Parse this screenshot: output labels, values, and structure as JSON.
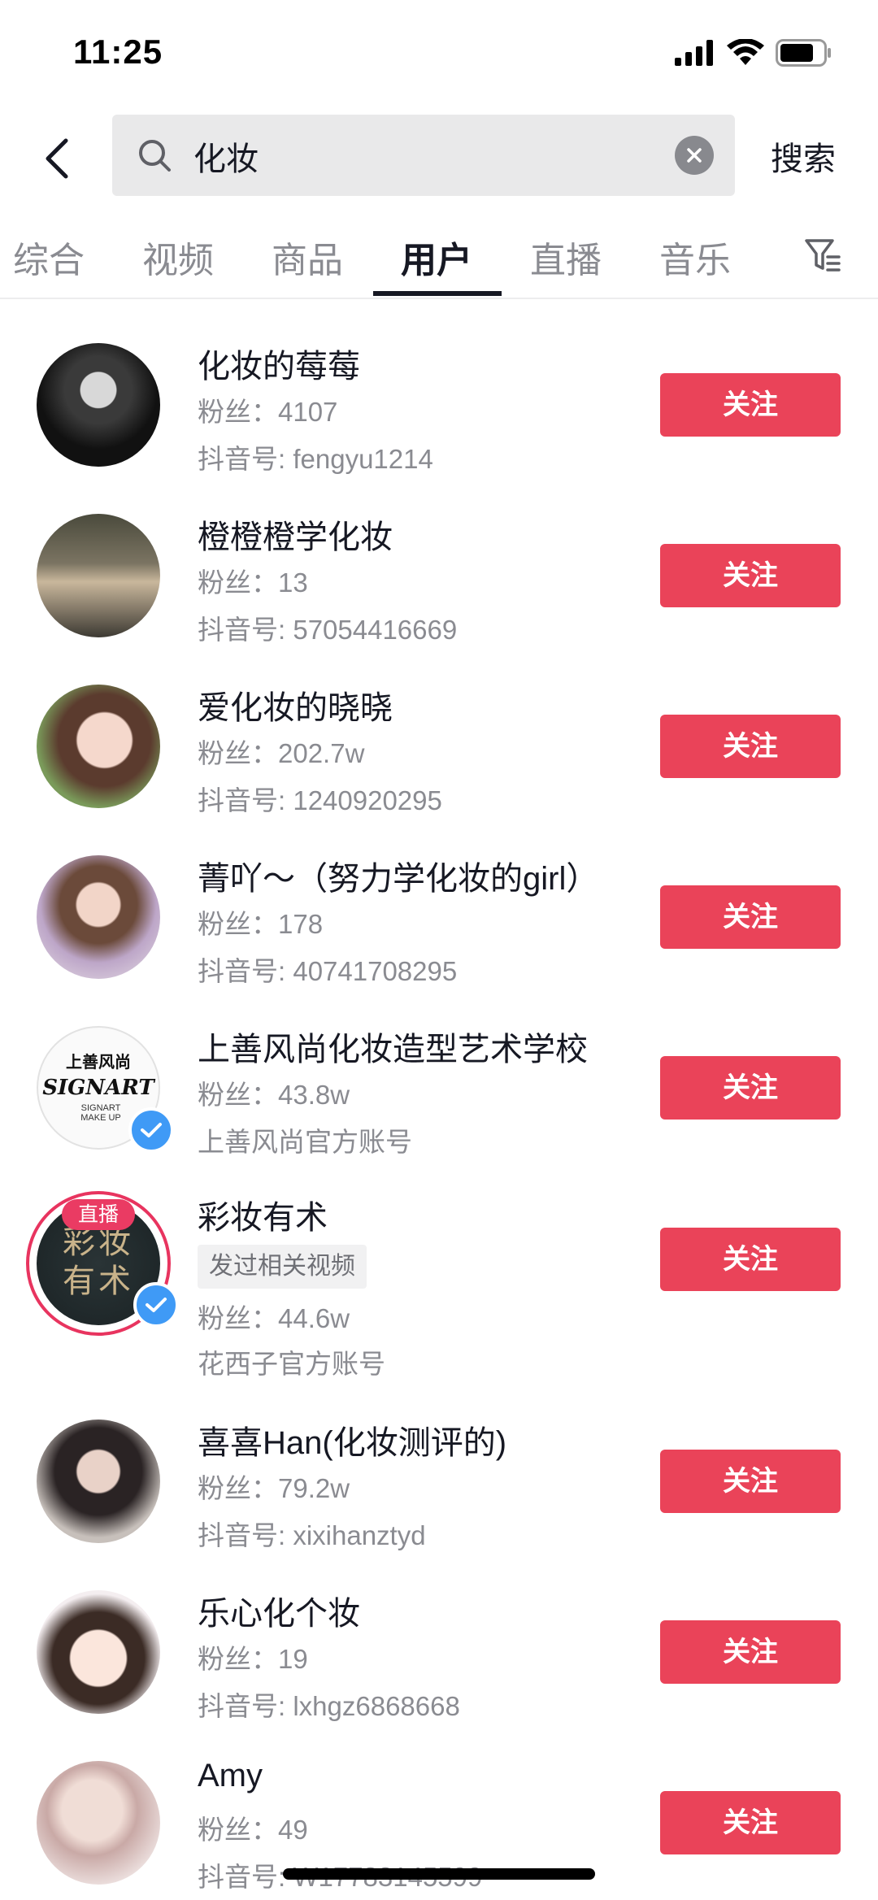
{
  "status_bar": {
    "time": "11:25"
  },
  "search": {
    "query": "化妆",
    "submit_label": "搜索"
  },
  "tabs": [
    {
      "label": "综合",
      "active": false
    },
    {
      "label": "视频",
      "active": false
    },
    {
      "label": "商品",
      "active": false
    },
    {
      "label": "用户",
      "active": true
    },
    {
      "label": "直播",
      "active": false
    },
    {
      "label": "音乐",
      "active": false
    }
  ],
  "users": [
    {
      "name": "化妆的莓莓",
      "fans": "粉丝：4107",
      "id_line": "抖音号: fengyu1214",
      "follow": "关注"
    },
    {
      "name": "橙橙橙学化妆",
      "fans": "粉丝：13",
      "id_line": "抖音号: 57054416669",
      "follow": "关注"
    },
    {
      "name": "爱化妆的晓晓",
      "fans": "粉丝：202.7w",
      "id_line": "抖音号: 1240920295",
      "follow": "关注"
    },
    {
      "name": "菁吖～（努力学化妆的girl）",
      "fans": "粉丝：178",
      "id_line": "抖音号: 40741708295",
      "follow": "关注"
    },
    {
      "name": "上善风尚化妆造型艺术学校",
      "fans": "粉丝：43.8w",
      "id_line": "上善风尚官方账号",
      "follow": "关注",
      "avatar_text_top": "上善风尚",
      "avatar_text_sign": "SIGNART",
      "avatar_text_bottom": "SIGNART MAKE UP"
    },
    {
      "name": "彩妆有术",
      "tag": "发过相关视频",
      "fans": "粉丝：44.6w",
      "id_line": "花西子官方账号",
      "follow": "关注",
      "live_label": "直播",
      "avatar_text": "彩妆有术"
    },
    {
      "name": "喜喜Han(化妆测评的)",
      "fans": "粉丝：79.2w",
      "id_line": "抖音号: xixihanztyd",
      "follow": "关注"
    },
    {
      "name": "乐心化个妆",
      "fans": "粉丝：19",
      "id_line": "抖音号: lxhgz6868668",
      "follow": "关注"
    },
    {
      "name": "Amy",
      "fans": "粉丝：49",
      "id_line": "抖音号: W17783145599",
      "follow": "关注"
    }
  ],
  "icons": {
    "back": "chevron-left-icon",
    "search": "search-icon",
    "clear": "clear-icon",
    "filter": "filter-icon",
    "verified": "verified-check-icon"
  },
  "colors": {
    "follow_button": "#ea4359",
    "verified_badge": "#3f9af6",
    "live_ring": "#e8345f"
  }
}
